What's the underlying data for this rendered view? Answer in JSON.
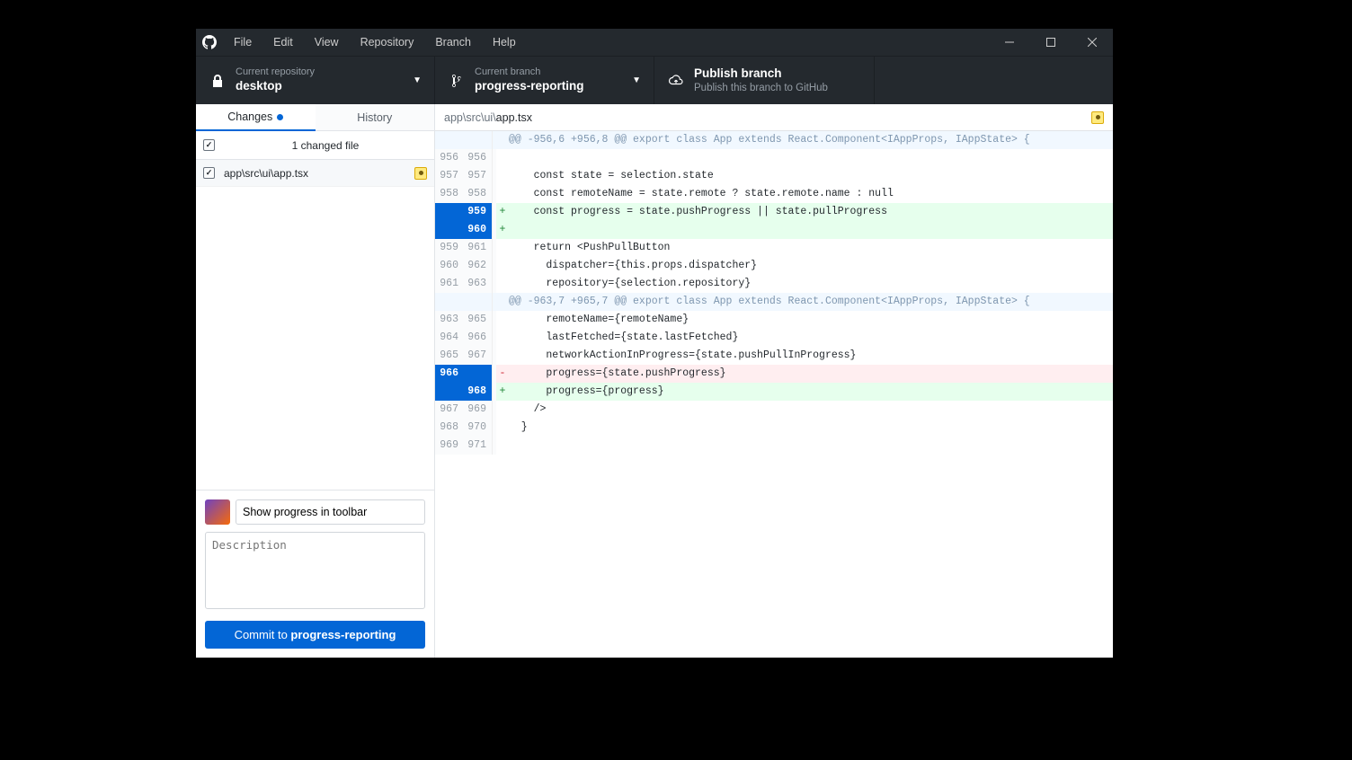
{
  "menus": [
    "File",
    "Edit",
    "View",
    "Repository",
    "Branch",
    "Help"
  ],
  "toolbar": {
    "repo": {
      "label": "Current repository",
      "value": "desktop"
    },
    "branch": {
      "label": "Current branch",
      "value": "progress-reporting"
    },
    "publish": {
      "title": "Publish branch",
      "subtitle": "Publish this branch to GitHub"
    }
  },
  "sidebar": {
    "tabs": {
      "changes": "Changes",
      "history": "History"
    },
    "changed_files_label": "1 changed file",
    "file_path": "app\\src\\ui\\app.tsx"
  },
  "commit": {
    "summary_value": "Show progress in toolbar",
    "description_placeholder": "Description",
    "button_prefix": "Commit to ",
    "button_branch": "progress-reporting"
  },
  "diff": {
    "path_prefix": "app\\src\\ui\\",
    "filename": "app.tsx",
    "lines": [
      {
        "type": "hunk",
        "old": "",
        "new": "",
        "sign": "",
        "text": "@@ -956,6 +956,8 @@ export class App extends React.Component<IAppProps, IAppState> {"
      },
      {
        "type": "ctx",
        "old": "956",
        "new": "956",
        "sign": "",
        "text": ""
      },
      {
        "type": "ctx",
        "old": "957",
        "new": "957",
        "sign": "",
        "text": "    const state = selection.state"
      },
      {
        "type": "ctx",
        "old": "958",
        "new": "958",
        "sign": "",
        "text": "    const remoteName = state.remote ? state.remote.name : null"
      },
      {
        "type": "add",
        "old": "",
        "new": "959",
        "sign": "+",
        "text": "    const progress = state.pushProgress || state.pullProgress",
        "sel": "new"
      },
      {
        "type": "add",
        "old": "",
        "new": "960",
        "sign": "+",
        "text": "",
        "sel": "new"
      },
      {
        "type": "ctx",
        "old": "959",
        "new": "961",
        "sign": "",
        "text": "    return <PushPullButton"
      },
      {
        "type": "ctx",
        "old": "960",
        "new": "962",
        "sign": "",
        "text": "      dispatcher={this.props.dispatcher}"
      },
      {
        "type": "ctx",
        "old": "961",
        "new": "963",
        "sign": "",
        "text": "      repository={selection.repository}"
      },
      {
        "type": "hunk",
        "old": "",
        "new": "",
        "sign": "",
        "text": "@@ -963,7 +965,7 @@ export class App extends React.Component<IAppProps, IAppState> {"
      },
      {
        "type": "ctx",
        "old": "963",
        "new": "965",
        "sign": "",
        "text": "      remoteName={remoteName}"
      },
      {
        "type": "ctx",
        "old": "964",
        "new": "966",
        "sign": "",
        "text": "      lastFetched={state.lastFetched}"
      },
      {
        "type": "ctx",
        "old": "965",
        "new": "967",
        "sign": "",
        "text": "      networkActionInProgress={state.pushPullInProgress}"
      },
      {
        "type": "del",
        "old": "966",
        "new": "",
        "sign": "-",
        "text": "      progress={state.pushProgress}",
        "sel": "old"
      },
      {
        "type": "add",
        "old": "",
        "new": "968",
        "sign": "+",
        "text": "      progress={progress}",
        "sel": "new"
      },
      {
        "type": "ctx",
        "old": "967",
        "new": "969",
        "sign": "",
        "text": "    />"
      },
      {
        "type": "ctx",
        "old": "968",
        "new": "970",
        "sign": "",
        "text": "  }"
      },
      {
        "type": "ctx",
        "old": "969",
        "new": "971",
        "sign": "",
        "text": ""
      }
    ]
  }
}
